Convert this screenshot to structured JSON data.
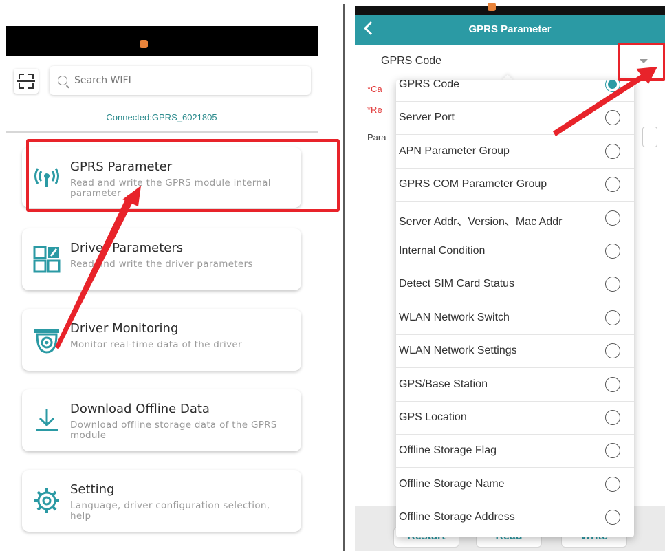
{
  "left": {
    "scan_icon": "scan-icon",
    "search": {
      "placeholder": "Search WIFI"
    },
    "connected": "Connected:GPRS_6021805",
    "cards": [
      {
        "name": "gprs-parameter",
        "icon": "antenna-icon",
        "title": "GPRS Parameter",
        "desc": "Read and write the GPRS module internal parameter"
      },
      {
        "name": "driver-parameters",
        "icon": "grid-edit-icon",
        "title": "Driver Parameters",
        "desc": "Read and write the driver parameters"
      },
      {
        "name": "driver-monitoring",
        "icon": "camera-monitor-icon",
        "title": "Driver Monitoring",
        "desc": "Monitor real-time data of the driver"
      },
      {
        "name": "download-offline-data",
        "icon": "download-icon",
        "title": "Download Offline Data",
        "desc": "Download offline storage data of the GPRS module"
      },
      {
        "name": "setting",
        "icon": "gear-icon",
        "title": "Setting",
        "desc": "Language, driver configuration selection, help"
      }
    ]
  },
  "right": {
    "header": {
      "title": "GPRS Parameter",
      "back_icon": "back-icon"
    },
    "selected": "GPRS Code",
    "background_fragments": {
      "ca": "*Ca",
      "re": "*Re",
      "para": "Para"
    },
    "dropdown_items": [
      {
        "label": "GPRS Code",
        "selected": true
      },
      {
        "label": "Server Port",
        "selected": false
      },
      {
        "label": "APN Parameter Group",
        "selected": false
      },
      {
        "label": "GPRS COM Parameter Group",
        "selected": false
      },
      {
        "label": "Server Addr、Version、Mac Addr",
        "selected": false
      },
      {
        "label": "Internal Condition",
        "selected": false
      },
      {
        "label": "Detect SIM Card Status",
        "selected": false
      },
      {
        "label": "WLAN Network Switch",
        "selected": false
      },
      {
        "label": "WLAN Network Settings",
        "selected": false
      },
      {
        "label": "GPS/Base Station",
        "selected": false
      },
      {
        "label": "GPS Location",
        "selected": false
      },
      {
        "label": "Offline Storage Flag",
        "selected": false
      },
      {
        "label": "Offline Storage Name",
        "selected": false
      },
      {
        "label": "Offline Storage Address",
        "selected": false
      }
    ],
    "buttons": {
      "restart": "Restart",
      "read": "Read",
      "write": "Write"
    }
  },
  "colors": {
    "accent": "#2b9aa4",
    "highlight": "#e8232a"
  }
}
